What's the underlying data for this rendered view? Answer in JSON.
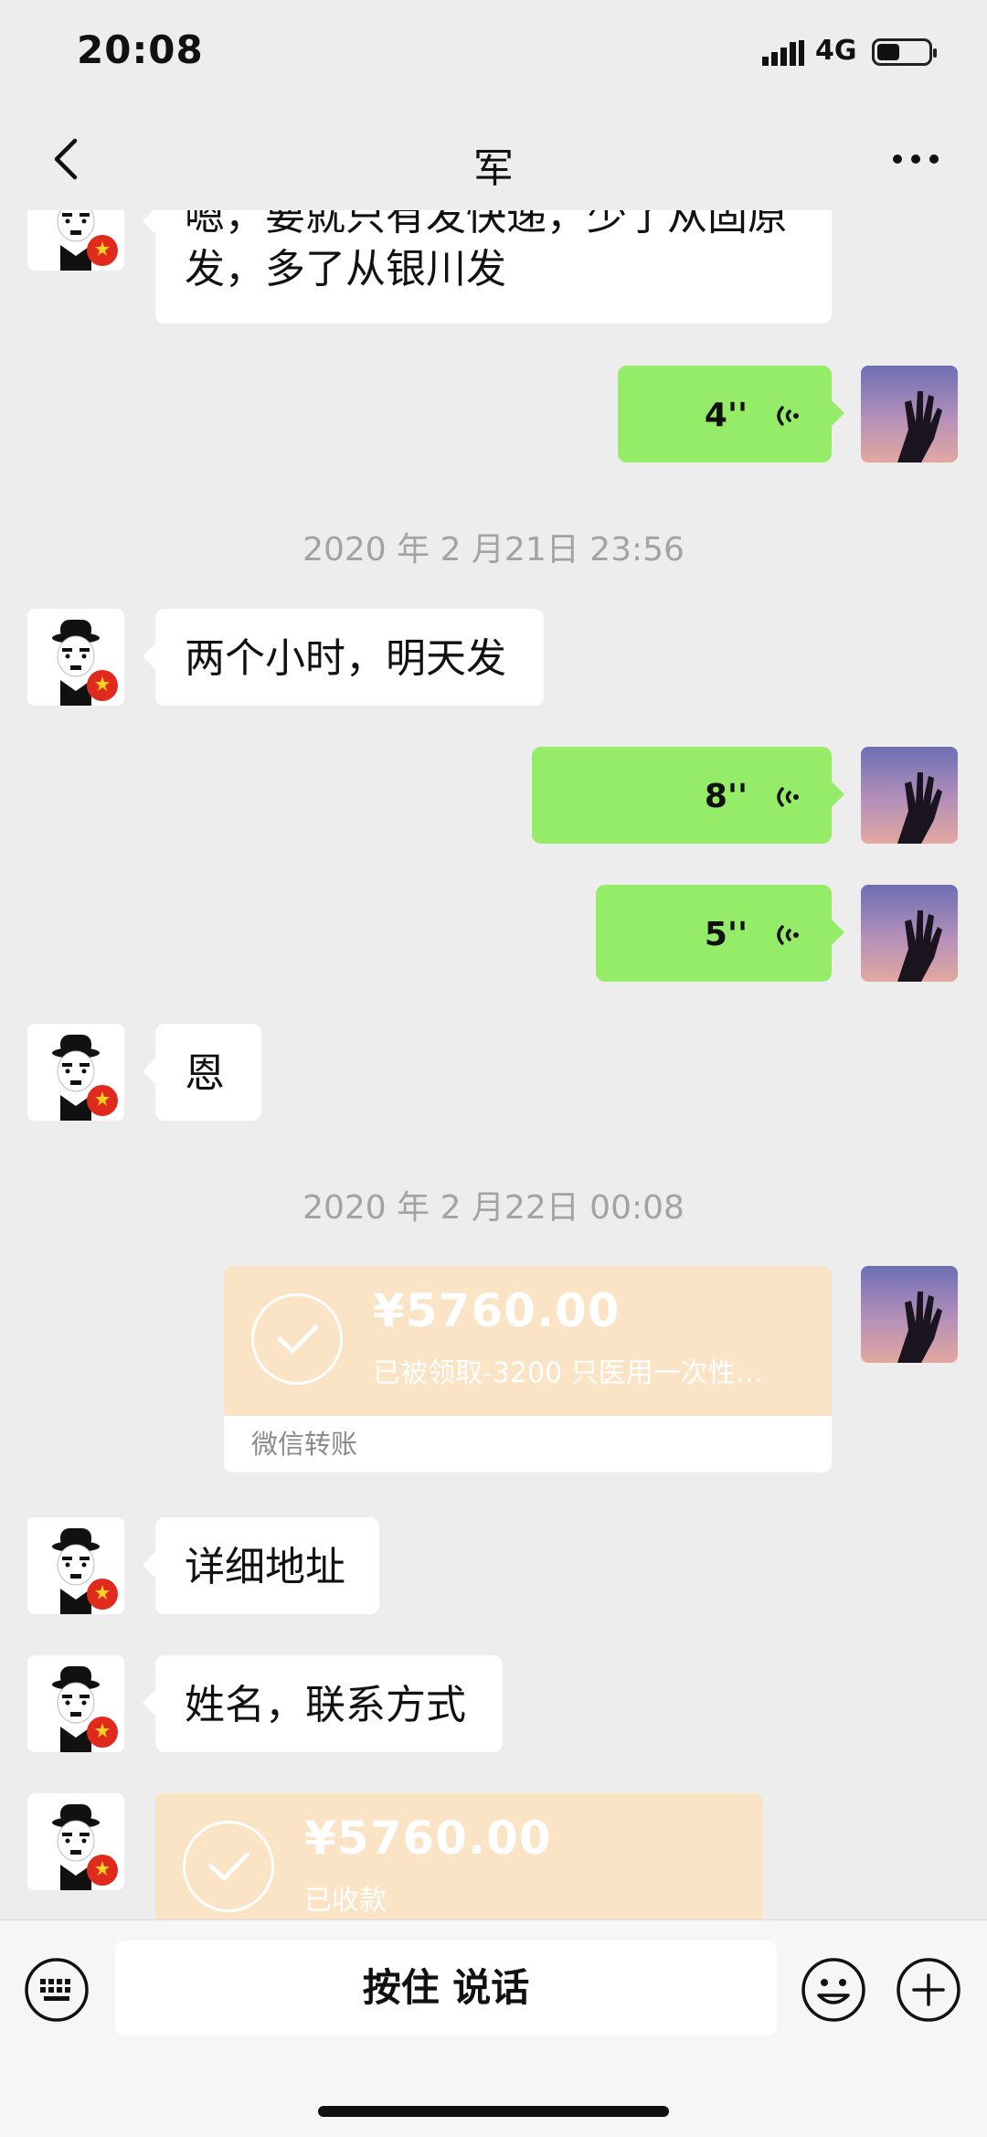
{
  "status": {
    "time": "20:08",
    "network": "4G"
  },
  "nav": {
    "title": "军"
  },
  "messages": {
    "m1": "嗯，要就只有发快递，少了从固原发，多了从银川发",
    "v1": "4''",
    "ts1": "2020 年 2 月21日 23:56",
    "m2": "两个小时，明天发",
    "v2": "8''",
    "v3": "5''",
    "m3": "恩",
    "ts2": "2020 年 2 月22日 00:08",
    "t1": {
      "amount": "¥5760.00",
      "desc": "已被领取-3200 只医用一次性…",
      "label": "微信转账"
    },
    "m4": "详细地址",
    "m5": "姓名，联系方式",
    "t2": {
      "amount": "¥5760.00",
      "desc": "已收款"
    }
  },
  "input": {
    "talk_label": "按住 说话"
  },
  "colors": {
    "green_bubble": "#95ec69",
    "transfer": "#fbe3c5",
    "background": "#ededed"
  }
}
